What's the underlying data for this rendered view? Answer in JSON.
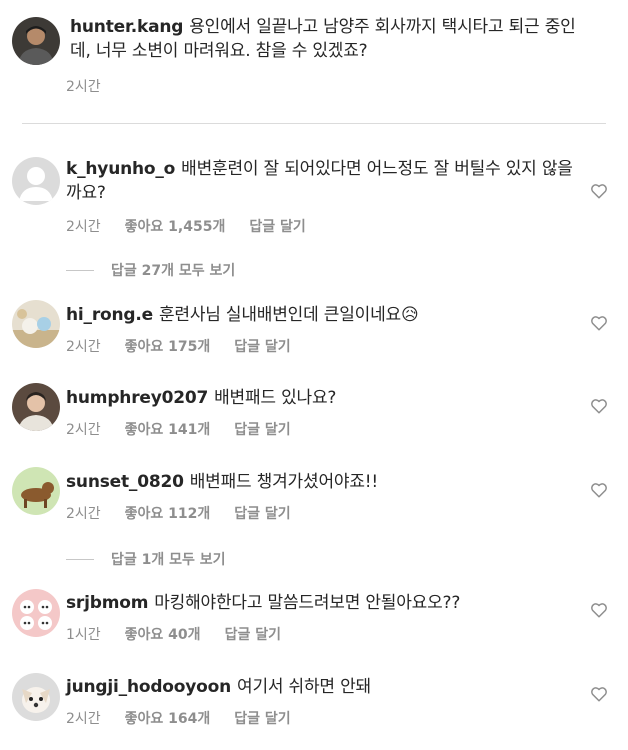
{
  "post": {
    "username": "hunter.kang",
    "text": "용인에서 일끝나고 남양주 회사까지 택시타고 퇴근 중인데, 너무 소변이 마려워요. 참을 수 있겠죠?",
    "time": "2시간"
  },
  "labels": {
    "like": "좋아요",
    "reply": "답글 달기"
  },
  "comments": [
    {
      "username": "k_hyunho_o",
      "text": "배변훈련이 잘 되어있다면 어느정도 잘 버틸수 있지 않을까요?",
      "time": "2시간",
      "likes": "좋아요 1,455개",
      "reply": "답글 달기",
      "view_replies": "답글 27개 모두 보기"
    },
    {
      "username": "hi_rong.e",
      "text": "훈련사님 실내배변인데 큰일이네요😥",
      "time": "2시간",
      "likes": "좋아요 175개",
      "reply": "답글 달기"
    },
    {
      "username": "humphrey0207",
      "text": "배변패드 있나요?",
      "time": "2시간",
      "likes": "좋아요 141개",
      "reply": "답글 달기"
    },
    {
      "username": "sunset_0820",
      "text": "배변패드 챙겨가셨어야죠!!",
      "time": "2시간",
      "likes": "좋아요 112개",
      "reply": "답글 달기",
      "view_replies": "답글 1개 모두 보기"
    },
    {
      "username": "srjbmom",
      "text": "마킹해야한다고 말씀드려보면 안될아요오??",
      "time": "1시간",
      "likes": "좋아요 40개",
      "reply": "답글 달기"
    },
    {
      "username": "jungji_hodooyoon",
      "text": "여기서 쉬하면 안돼",
      "time": "2시간",
      "likes": "좋아요 164개",
      "reply": "답글 달기"
    }
  ],
  "icons": {
    "like": "heart-outline-icon"
  },
  "colors": {
    "text": "#262626",
    "secondary": "#8e8e8e",
    "divider": "#dbdbdb"
  }
}
